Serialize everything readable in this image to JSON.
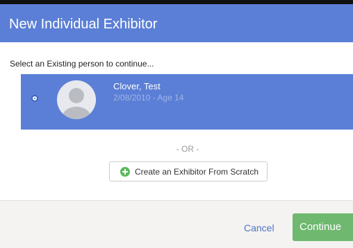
{
  "modal": {
    "title": "New Individual Exhibitor",
    "prompt": "Select an Existing person to continue...",
    "person": {
      "name": "Clover, Test",
      "meta": "2/08/2010 - Age 14",
      "selected": true
    },
    "or_text": "- OR -",
    "create_button": {
      "label": "Create an Exhibitor From Scratch",
      "icon": "plus-circle-icon"
    },
    "footer": {
      "cancel_label": "Cancel",
      "continue_label": "Continue"
    }
  },
  "colors": {
    "header": "#5b7fd6",
    "selected_row": "#5b7fd6",
    "continue": "#6fb86f",
    "cancel_link": "#4a74c9",
    "plus_icon": "#5cb85c"
  }
}
